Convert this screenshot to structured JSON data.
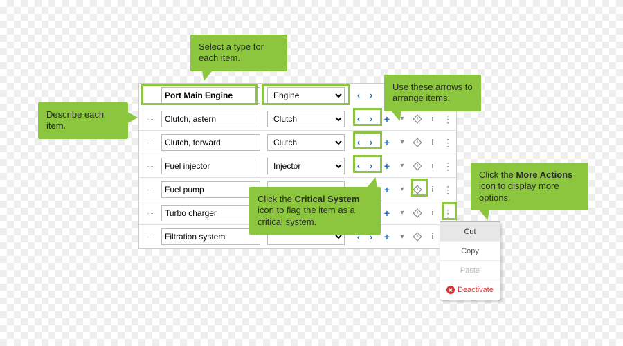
{
  "colors": {
    "accent": "#8cc63f",
    "link": "#2b6ebf",
    "danger": "#d33"
  },
  "callouts": {
    "describe": "Describe each item.",
    "selectType": "Select a type for each item.",
    "arrows": "Use these arrows to arrange items.",
    "critical_pre": "Click the ",
    "critical_bold": "Critical System",
    "critical_post": " icon to flag the item as a critical system.",
    "more_pre": "Click the ",
    "more_bold": "More Actions",
    "more_post": " icon to display more options."
  },
  "parent": {
    "name": "Port Main Engine",
    "type": "Engine"
  },
  "rows": [
    {
      "name": "Clutch, astern",
      "type": "Clutch"
    },
    {
      "name": "Clutch, forward",
      "type": "Clutch"
    },
    {
      "name": "Fuel injector",
      "type": "Injector"
    },
    {
      "name": "Fuel pump",
      "type": ""
    },
    {
      "name": "Turbo charger",
      "type": ""
    },
    {
      "name": "Filtration system",
      "type": ""
    }
  ],
  "contextMenu": {
    "cut": "Cut",
    "copy": "Copy",
    "paste": "Paste",
    "deactivate": "Deactivate"
  },
  "icons": {
    "plus": "plus-icon",
    "chevron": "chevron-down-icon",
    "critical": "critical-system-icon",
    "info": "info-icon",
    "more": "more-actions-icon",
    "left": "arrow-left-icon",
    "right": "arrow-right-icon"
  }
}
